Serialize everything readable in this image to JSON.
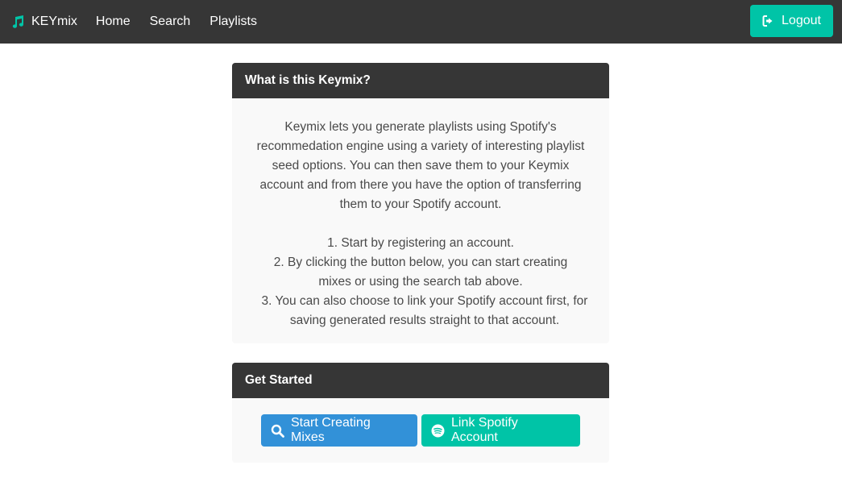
{
  "nav": {
    "brand": "KEYmix",
    "links": [
      "Home",
      "Search",
      "Playlists"
    ],
    "logout": "Logout",
    "brand_icon": "music-note-icon",
    "logout_icon": "sign-out-icon"
  },
  "about": {
    "title": "What is this Keymix?",
    "intro": "Keymix lets you generate playlists using Spotify's recommedation engine using a variety of interesting playlist seed options. You can then save them to your Keymix account and from there you have the option of transferring them to your Spotify account.",
    "steps": [
      "1. Start by registering an account.",
      "2. By clicking the button below, you can start creating mixes or using the search tab above.",
      "3. You can also choose to link your Spotify account first, for saving generated results straight to that account."
    ]
  },
  "get_started": {
    "title": "Get Started",
    "start_button": "Start Creating Mixes",
    "link_button": "Link Spotify Account",
    "start_icon": "search-icon",
    "link_icon": "spotify-icon"
  },
  "colors": {
    "navbar": "#363636",
    "accent_teal": "#00c4a7",
    "accent_blue": "#3291d8",
    "card_bg": "#f9f9f9"
  }
}
